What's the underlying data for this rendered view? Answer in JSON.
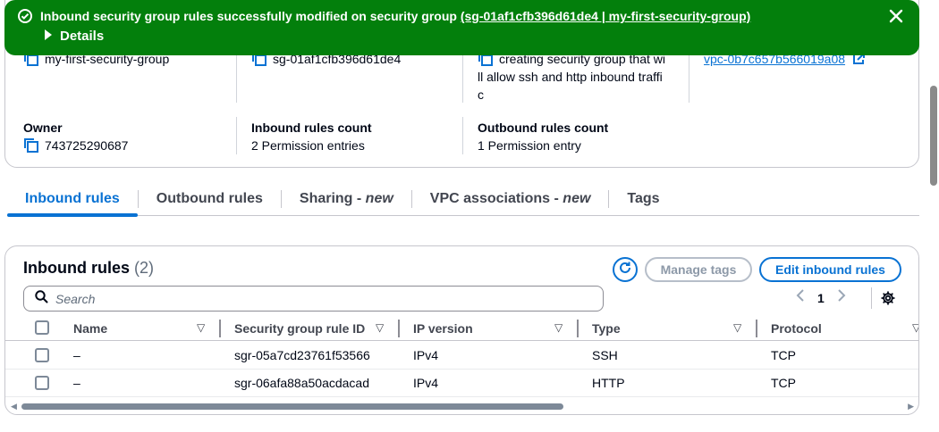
{
  "banner": {
    "message_prefix": "Inbound security group rules successfully modified on security group",
    "message_link": "(sg-01af1cfb396d61de4 | my-first-security-group)",
    "details_label": "Details",
    "status_color": "#037f0c"
  },
  "details": {
    "name": "my-first-security-group",
    "id": "sg-01af1cfb396d61de4",
    "description_lines": [
      "creating security group that wi",
      "ll allow ssh and http inbound traffi",
      "c"
    ],
    "vpc": "vpc-0b7c657b566019a08",
    "owner_label": "Owner",
    "owner_value": "743725290687",
    "inbound_count_label": "Inbound rules count",
    "inbound_count_value": "2 Permission entries",
    "outbound_count_label": "Outbound rules count",
    "outbound_count_value": "1 Permission entry"
  },
  "tabs": [
    {
      "label": "Inbound rules",
      "suffix": ""
    },
    {
      "label": "Outbound rules",
      "suffix": ""
    },
    {
      "label": "Sharing - ",
      "suffix": "new"
    },
    {
      "label": "VPC associations - ",
      "suffix": "new"
    },
    {
      "label": "Tags",
      "suffix": ""
    }
  ],
  "panel": {
    "title": "Inbound rules",
    "count": "(2)",
    "manage_tags": "Manage tags",
    "edit_rules": "Edit inbound rules",
    "search_placeholder": "Search",
    "page": "1",
    "columns": [
      "Name",
      "Security group rule ID",
      "IP version",
      "Type",
      "Protocol"
    ],
    "rows": [
      {
        "name": "–",
        "rule_id": "sgr-05a7cd23761f53566",
        "ip": "IPv4",
        "type": "SSH",
        "protocol": "TCP"
      },
      {
        "name": "–",
        "rule_id": "sgr-06afa88a50acdacad",
        "ip": "IPv4",
        "type": "HTTP",
        "protocol": "TCP"
      }
    ]
  },
  "colors": {
    "accent": "#0972d3",
    "text": "#000716",
    "muted": "#424650"
  }
}
